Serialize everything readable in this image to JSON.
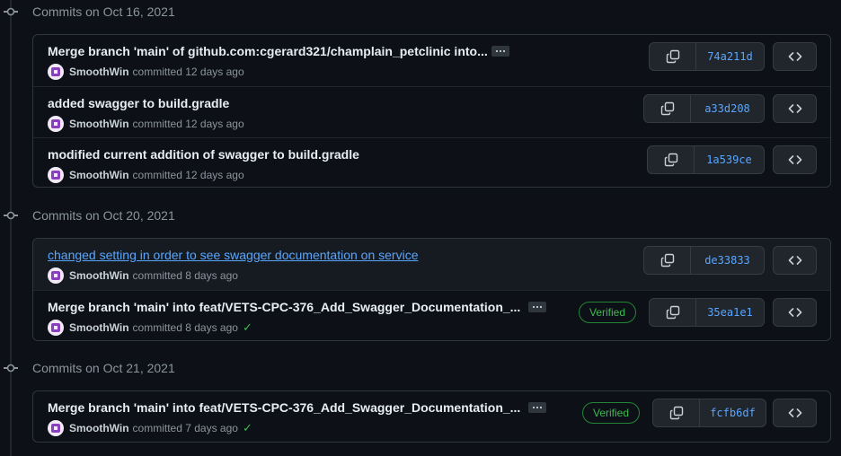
{
  "groups": [
    {
      "header": "Commits on Oct 16, 2021",
      "commits": [
        {
          "message": "Merge branch 'main' of github.com:cgerard321/champlain_petclinic into...",
          "author": "SmoothWin",
          "time": "committed 12 days ago",
          "sha": "74a211d"
        },
        {
          "message": "added swagger to build.gradle",
          "author": "SmoothWin",
          "time": "committed 12 days ago",
          "sha": "a33d208"
        },
        {
          "message": "modified current addition of swagger to build.gradle",
          "author": "SmoothWin",
          "time": "committed 12 days ago",
          "sha": "1a539ce"
        }
      ]
    },
    {
      "header": "Commits on Oct 20, 2021",
      "commits": [
        {
          "message": "changed setting in order to see swagger documentation on service",
          "author": "SmoothWin",
          "time": "committed 8 days ago",
          "sha": "de33833"
        },
        {
          "message": "Merge branch 'main' into feat/VETS-CPC-376_Add_Swagger_Documentation_...",
          "author": "SmoothWin",
          "time": "committed 8 days ago",
          "sha": "35ea1e1",
          "verified": "Verified"
        }
      ]
    },
    {
      "header": "Commits on Oct 21, 2021",
      "commits": [
        {
          "message": "Merge branch 'main' into feat/VETS-CPC-376_Add_Swagger_Documentation_...",
          "author": "SmoothWin",
          "time": "committed 7 days ago",
          "sha": "fcfb6df",
          "verified": "Verified"
        }
      ]
    }
  ],
  "colors": {
    "background": "#0d1117",
    "link": "#58a6ff",
    "verified": "#3fb950",
    "border": "#30363d"
  },
  "icons": {
    "timeline": "git-commit-icon",
    "copy": "copy-icon",
    "browse": "code-icon",
    "status": "check-icon"
  }
}
